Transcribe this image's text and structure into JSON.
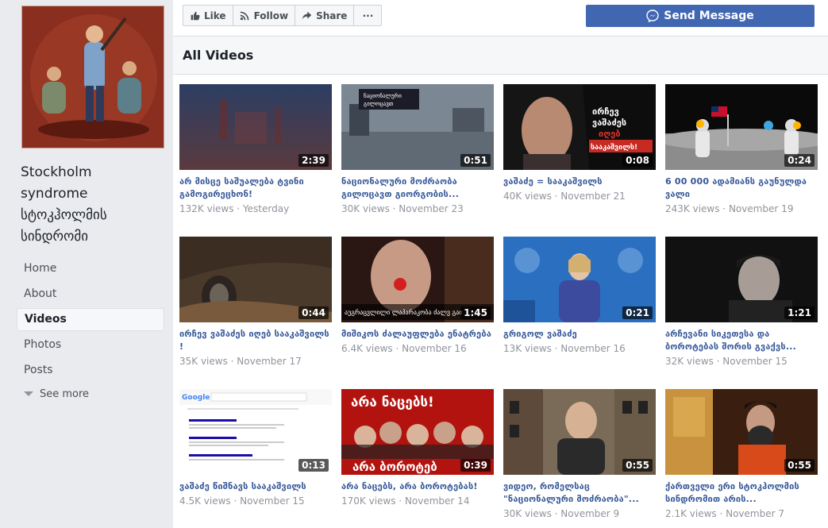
{
  "page": {
    "name_line1": "Stockholm",
    "name_line2": "syndrome",
    "name_line3": "სტოკჰოლმის",
    "name_line4": "სინდრომი"
  },
  "nav": {
    "items": [
      "Home",
      "About",
      "Videos",
      "Photos",
      "Posts"
    ],
    "see_more": "See more"
  },
  "actions": {
    "like": "Like",
    "follow": "Follow",
    "share": "Share",
    "more": "···",
    "send_message": "Send Message"
  },
  "section": {
    "title": "All Videos"
  },
  "videos": [
    {
      "title": "არ მისცე საშუალება ტვინი გამოგირეცხონ!",
      "views": "132K views",
      "date": "Yesterday",
      "duration": "2:39"
    },
    {
      "title": "ნაციონალური მოძრაობა გილოცავთ გიორგობის...",
      "views": "30K views",
      "date": "November 23",
      "duration": "0:51"
    },
    {
      "title": "ვაშაძე = სააკაშვილს",
      "views": "40K views",
      "date": "November 21",
      "duration": "0:08"
    },
    {
      "title": "6 00 000 ადამიანს გაუნულდა ვალი",
      "views": "243K views",
      "date": "November 19",
      "duration": "0:24"
    },
    {
      "title": "ირჩევ ვაშაძეს იღებ სააკაშვილს !",
      "views": "35K views",
      "date": "November 17",
      "duration": "0:44"
    },
    {
      "title": "მიშიკოს ძალაუფლება ენატრება",
      "views": "6.4K views",
      "date": "November 16",
      "duration": "1:45"
    },
    {
      "title": "გრიგოლ ვაშაძე",
      "views": "13K views",
      "date": "November 16",
      "duration": "0:21"
    },
    {
      "title": "არჩევანი სიკეთესა და ბოროტებას შორის გვაქვს...",
      "views": "32K views",
      "date": "November 15",
      "duration": "1:21"
    },
    {
      "title": "ვაშაძე წიშნავს სააკაშვილს",
      "views": "4.5K views",
      "date": "November 15",
      "duration": "0:13"
    },
    {
      "title": "არა ნაცებს, არა ბოროტებას!",
      "views": "170K views",
      "date": "November 14",
      "duration": "0:39"
    },
    {
      "title": "ვიდეო, რომელსაც \"ნაციონალური მოძრაობა\"...",
      "views": "30K views",
      "date": "November 9",
      "duration": "0:55"
    },
    {
      "title": "ქართველი ერი სტოკჰოლმის სინდრომით არის...",
      "views": "2.1K views",
      "date": "November 7",
      "duration": "0:55"
    }
  ],
  "thumb_text": {
    "v3_overlay": "ირჩევ ვაშაძეს იღებ სააკაშვილს!",
    "v6_caption": "აუგრაცვლილი ლაპარაკობა ძალვ გაი",
    "v10_top": "არა ნაცებს!",
    "v10_bottom": "არა ბოროტებ",
    "v9_brand": "Google"
  },
  "colors": {
    "brand_blue": "#4267b2",
    "link_blue": "#365899",
    "meta_gray": "#90949c"
  }
}
